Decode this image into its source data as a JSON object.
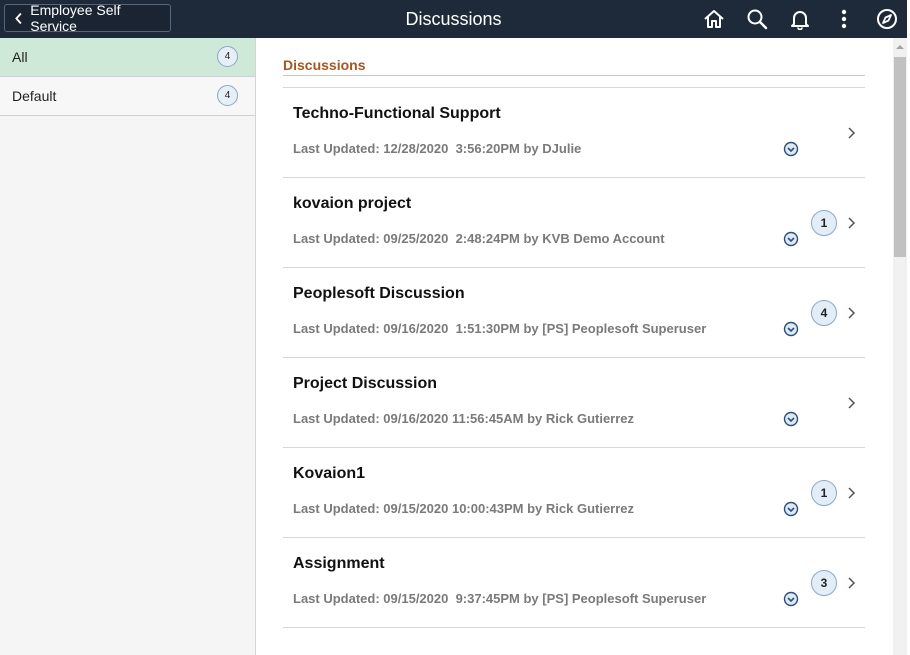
{
  "header": {
    "back_label": "Employee Self Service",
    "title": "Discussions",
    "icons": [
      "home-icon",
      "search-icon",
      "bell-icon",
      "more-vertical-icon",
      "compass-icon"
    ]
  },
  "sidebar": {
    "items": [
      {
        "label": "All",
        "count": "4",
        "active": true
      },
      {
        "label": "Default",
        "count": "4",
        "active": false
      }
    ]
  },
  "main": {
    "section_title": "Discussions",
    "discussions": [
      {
        "title": "Techno-Functional Support",
        "meta": "Last Updated: 12/28/2020  3:56:20PM by DJulie",
        "replies": ""
      },
      {
        "title": "kovaion project",
        "meta": "Last Updated: 09/25/2020  2:48:24PM by KVB Demo Account",
        "replies": "1"
      },
      {
        "title": "Peoplesoft Discussion",
        "meta": "Last Updated: 09/16/2020  1:51:30PM by [PS] Peoplesoft Superuser",
        "replies": "4"
      },
      {
        "title": "Project Discussion",
        "meta": "Last Updated: 09/16/2020 11:56:45AM by Rick Gutierrez",
        "replies": ""
      },
      {
        "title": "Kovaion1",
        "meta": "Last Updated: 09/15/2020 10:00:43PM by Rick Gutierrez",
        "replies": "1"
      },
      {
        "title": "Assignment",
        "meta": "Last Updated: 09/15/2020  9:37:45PM by [PS] Peoplesoft Superuser",
        "replies": "3"
      }
    ]
  },
  "colors": {
    "header_bg": "#1e2a3a",
    "active_item_bg": "#cfe9d8",
    "section_title": "#a4571f",
    "badge_bg": "#e3edf8",
    "badge_border": "#8aa8c8"
  }
}
